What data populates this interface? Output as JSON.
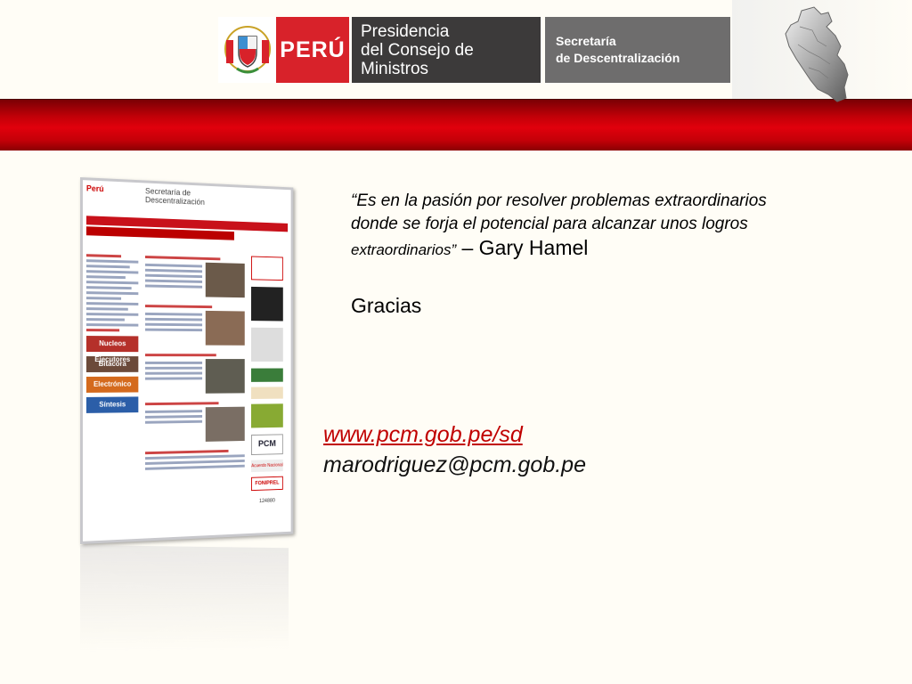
{
  "header": {
    "peru": "PERÚ",
    "presidencia_line1": "Presidencia",
    "presidencia_line2": "del Consejo de Ministros",
    "secretaria_line1": "Secretaría",
    "secretaria_line2": "de Descentralización",
    "crest_text": "REPÚBLICA DEL PERÚ"
  },
  "colors": {
    "brand_red": "#d8222a",
    "bar_red": "#e1000c",
    "dark_grey": "#3c3a3a",
    "mid_grey": "#6e6d6d",
    "link_red": "#c00000"
  },
  "screenshot": {
    "site_logo": "Perú",
    "site_title_line1": "Secretaría de",
    "site_title_line2": "Descentralización",
    "side_buttons": [
      "Nucleos Ejecutores",
      "Bitácora",
      "Electrónico",
      "Síntesis"
    ],
    "badges": [
      "Acuerdo Nacional",
      "FONIPREL"
    ],
    "counter": "124880"
  },
  "quote": {
    "text_line1": "“Es en la pasión por resolver problemas extraordinarios",
    "text_line2": "donde se forja el potencial para alcanzar unos logros",
    "text_line3": "extraordinarios”",
    "author": " – Gary Hamel"
  },
  "thanks": "Gracias",
  "contact": {
    "url": "www.pcm.gob.pe/sd",
    "email": "marodriguez@pcm.gob.pe"
  },
  "icons": [
    "peru-crest-icon",
    "peru-map-icon"
  ]
}
